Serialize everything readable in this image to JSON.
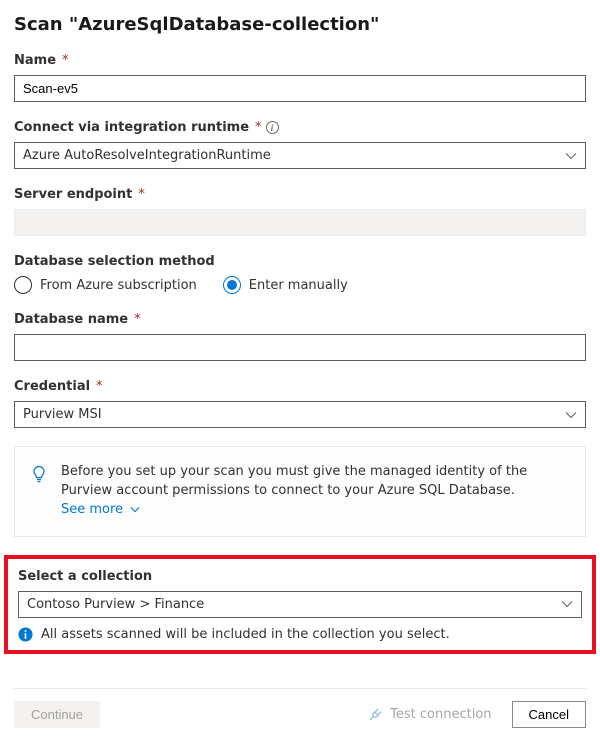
{
  "page_title": "Scan \"AzureSqlDatabase-collection\"",
  "fields": {
    "name": {
      "label": "Name",
      "value": "Scan-ev5"
    },
    "integration_runtime": {
      "label": "Connect via integration runtime",
      "value": "Azure AutoResolveIntegrationRuntime"
    },
    "server_endpoint": {
      "label": "Server endpoint",
      "value": ""
    },
    "db_selection": {
      "label": "Database selection method",
      "options": {
        "from_subscription": "From Azure subscription",
        "enter_manually": "Enter manually"
      },
      "selected": "enter_manually"
    },
    "database_name": {
      "label": "Database name",
      "value": ""
    },
    "credential": {
      "label": "Credential",
      "value": "Purview MSI"
    },
    "collection": {
      "label": "Select a collection",
      "value": "Contoso Purview > Finance"
    }
  },
  "info_panel": {
    "text": "Before you set up your scan you must give the managed identity of the Purview account permissions to connect to your Azure SQL Database.",
    "see_more": "See more"
  },
  "collection_note": "All assets scanned will be included in the collection you select.",
  "footer": {
    "continue": "Continue",
    "test_connection": "Test connection",
    "cancel": "Cancel"
  }
}
